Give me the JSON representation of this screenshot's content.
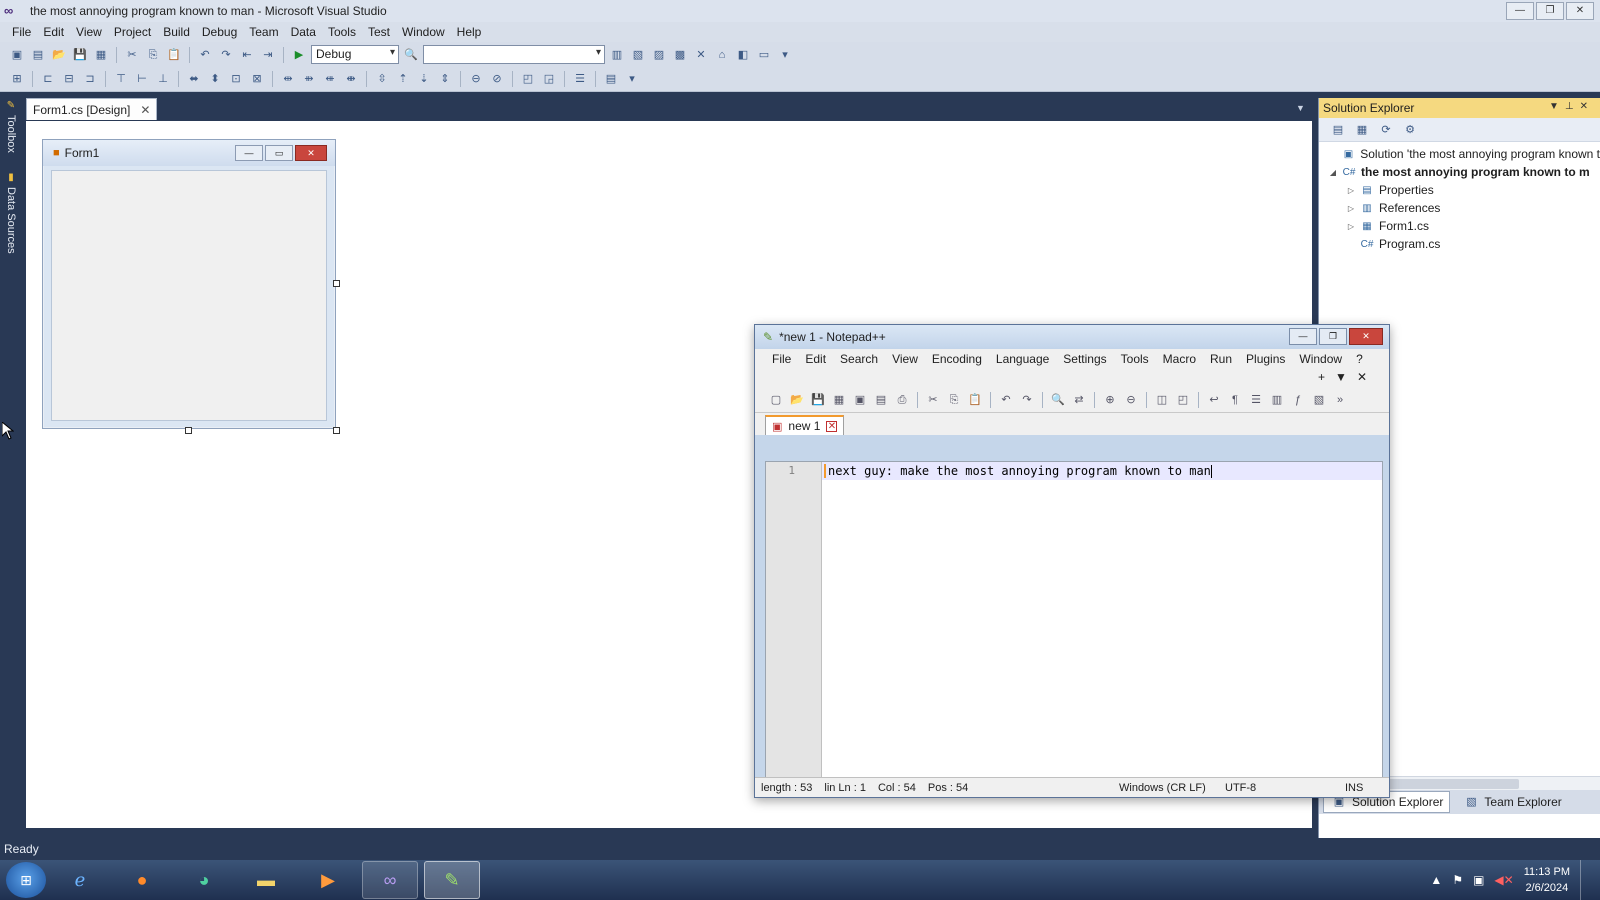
{
  "vs": {
    "title": "the most annoying program known to man - Microsoft Visual Studio",
    "menu": [
      "File",
      "Edit",
      "View",
      "Project",
      "Build",
      "Debug",
      "Team",
      "Data",
      "Tools",
      "Test",
      "Window",
      "Help"
    ],
    "toolbar": {
      "configuration": "Debug",
      "platform": ""
    },
    "side_tabs": {
      "toolbox": "Toolbox",
      "data_sources": "Data Sources"
    },
    "doc_tab": {
      "label": "Form1.cs [Design]"
    },
    "designer": {
      "form_title": "Form1"
    },
    "solution_explorer": {
      "title": "Solution Explorer",
      "tree": [
        {
          "label": "Solution 'the most annoying program known t",
          "level": 0
        },
        {
          "label": "the most annoying program known to m",
          "level": 1
        },
        {
          "label": "Properties",
          "level": 2
        },
        {
          "label": "References",
          "level": 2
        },
        {
          "label": "Form1.cs",
          "level": 2
        },
        {
          "label": "Program.cs",
          "level": 2
        }
      ],
      "bottom_tabs": [
        "Solution Explorer",
        "Team Explorer"
      ]
    },
    "status": "Ready"
  },
  "notepad": {
    "title": "*new 1 - Notepad++",
    "menu": [
      "File",
      "Edit",
      "Search",
      "View",
      "Encoding",
      "Language",
      "Settings",
      "Tools",
      "Macro",
      "Run",
      "Plugins",
      "Window",
      "?"
    ],
    "tab": "new 1",
    "line_number": "1",
    "content": "next guy: make the most annoying program known to man",
    "status": {
      "length": "length : 53",
      "line": "lin Ln : 1",
      "col": "Col : 54",
      "pos": "Pos : 54",
      "eol": "Windows (CR LF)",
      "encoding": "UTF-8",
      "mode": "INS"
    }
  },
  "taskbar": {
    "time": "11:13 PM",
    "date": "2/6/2024"
  }
}
